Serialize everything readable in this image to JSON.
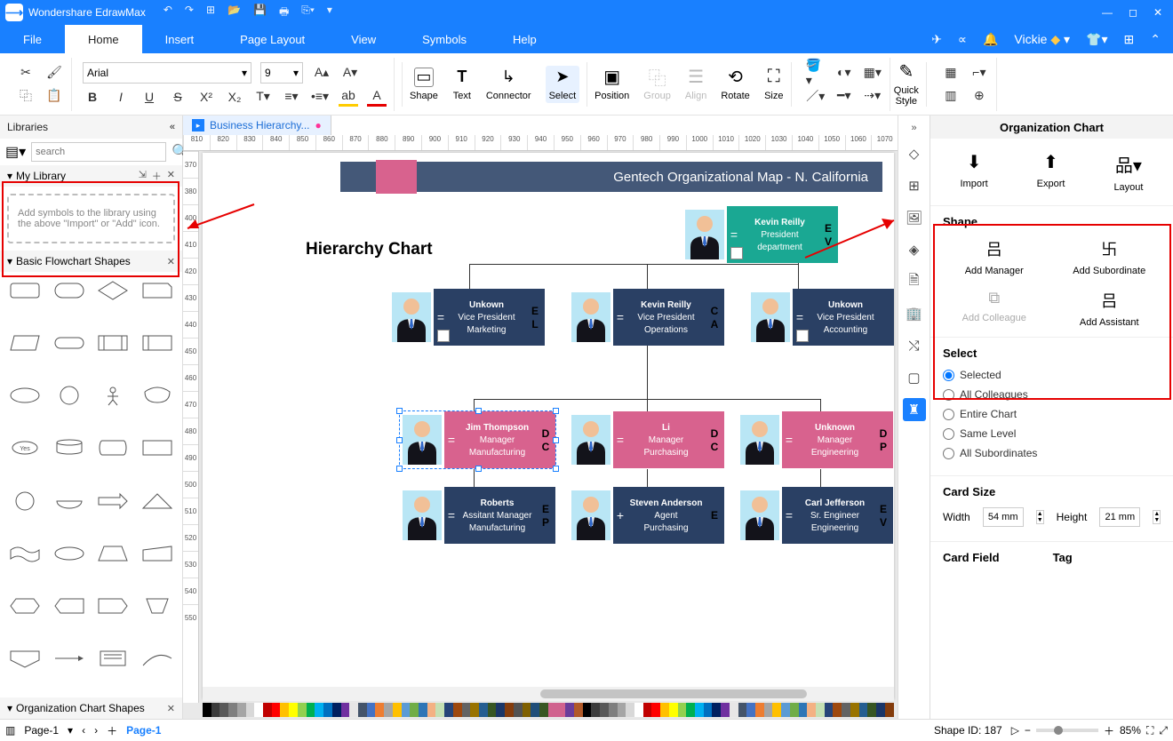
{
  "window": {
    "title": "Wondershare EdrawMax",
    "user": "Vickie"
  },
  "menus": {
    "file": "File",
    "home": "Home",
    "insert": "Insert",
    "page_layout": "Page Layout",
    "view": "View",
    "symbols": "Symbols",
    "help": "Help"
  },
  "ribbon": {
    "font_family": "Arial",
    "font_size": "9",
    "buttons": {
      "shape": "Shape",
      "text": "Text",
      "connector": "Connector",
      "select": "Select",
      "position": "Position",
      "group": "Group",
      "align": "Align",
      "rotate": "Rotate",
      "size": "Size",
      "quick_style": "Quick\nStyle"
    }
  },
  "libraries": {
    "title": "Libraries",
    "search_placeholder": "search",
    "my_library": "My Library",
    "my_library_hint": "Add symbols to the library using the above \"Import\" or \"Add\" icon.",
    "basic": "Basic Flowchart Shapes",
    "org": "Organization Chart Shapes"
  },
  "doc": {
    "tab_label": "Business Hierarchy..."
  },
  "canvas": {
    "banner": "Gentech Organizational Map - N. California",
    "hierarchy_title": "Hierarchy Chart",
    "cards": {
      "president": {
        "name": "Kevin Reilly",
        "title": "President",
        "dept": "department",
        "tag1": "E",
        "tag2": "V"
      },
      "vp_mkt": {
        "name": "Unkown",
        "title": "Vice President",
        "dept": "Marketing",
        "tag1": "E",
        "tag2": "L"
      },
      "vp_ops": {
        "name": "Kevin Reilly",
        "title": "Vice President",
        "dept": "Operations",
        "tag1": "C",
        "tag2": "A"
      },
      "vp_acc": {
        "name": "Unkown",
        "title": "Vice President",
        "dept": "Accounting",
        "tag1": "",
        "tag2": ""
      },
      "mgr_mfg": {
        "name": "Jim Thompson",
        "title": "Manager",
        "dept": "Manufacturing",
        "tag1": "D",
        "tag2": "C"
      },
      "mgr_pur": {
        "name": "Li",
        "title": "Manager",
        "dept": "Purchasing",
        "tag1": "D",
        "tag2": "C"
      },
      "mgr_eng": {
        "name": "Unknown",
        "title": "Manager",
        "dept": "Engineering",
        "tag1": "D",
        "tag2": "P"
      },
      "asm_mfg": {
        "name": "Roberts",
        "title": "Assitant Manager",
        "dept": "Manufacturing",
        "tag1": "E",
        "tag2": "P"
      },
      "agt_pur": {
        "name": "Steven Anderson",
        "title": "Agent",
        "dept": "Purchasing",
        "tag1": "E",
        "tag2": ""
      },
      "sre_eng": {
        "name": "Carl Jefferson",
        "title": "Sr. Engineer",
        "dept": "Engineering",
        "tag1": "E",
        "tag2": "V"
      }
    }
  },
  "props": {
    "title": "Organization Chart",
    "actions": {
      "import": "Import",
      "export": "Export",
      "layout": "Layout"
    },
    "shape_section": "Shape",
    "shape_buttons": {
      "add_manager": "Add Manager",
      "add_subordinate": "Add Subordinate",
      "add_colleague": "Add Colleague",
      "add_assistant": "Add Assistant"
    },
    "select_section": "Select",
    "select_options": {
      "selected": "Selected",
      "all_colleagues": "All Colleagues",
      "entire_chart": "Entire Chart",
      "same_level": "Same Level",
      "all_subordinates": "All Subordinates"
    },
    "card_size": "Card Size",
    "width_label": "Width",
    "width_val": "54 mm",
    "height_label": "Height",
    "height_val": "21 mm",
    "card_field": "Card Field",
    "tag": "Tag"
  },
  "footer": {
    "page_label": "Page-1",
    "page_tab": "Page-1",
    "shape_id_label": "Shape ID:",
    "shape_id": "187",
    "zoom": "85%"
  },
  "ruler_h": [
    "810",
    "820",
    "830",
    "840",
    "850",
    "860",
    "870",
    "880",
    "890",
    "900",
    "910",
    "920",
    "930",
    "940",
    "950",
    "960",
    "970",
    "980",
    "990",
    "1000",
    "1010",
    "1020",
    "1030",
    "1040",
    "1050",
    "1060",
    "1070"
  ],
  "ruler_v": [
    "370",
    "380",
    "400",
    "410",
    "420",
    "430",
    "440",
    "450",
    "460",
    "470",
    "480",
    "490",
    "500",
    "510",
    "520",
    "530",
    "540",
    "550"
  ],
  "colors": [
    "#000000",
    "#3b3b3b",
    "#595959",
    "#7f7f7f",
    "#a5a5a5",
    "#d8d8d8",
    "#ffffff",
    "#c00000",
    "#ff0000",
    "#ffc000",
    "#ffff00",
    "#92d050",
    "#00b050",
    "#00b0f0",
    "#0070c0",
    "#002060",
    "#7030a0",
    "#e7e6e6",
    "#44546a",
    "#4472c4",
    "#ed7d31",
    "#a5a5a5",
    "#ffc000",
    "#5b9bd5",
    "#70ad47",
    "#2e75b6",
    "#f4b183",
    "#c5e0b4",
    "#264478",
    "#9e480e",
    "#636363",
    "#997300",
    "#255e91",
    "#375623",
    "#1a3668",
    "#843c0c",
    "#525252",
    "#7f6000",
    "#1f4e79",
    "#385723",
    "#d0628e",
    "#d0628e",
    "#6a3d9a",
    "#b15928"
  ]
}
